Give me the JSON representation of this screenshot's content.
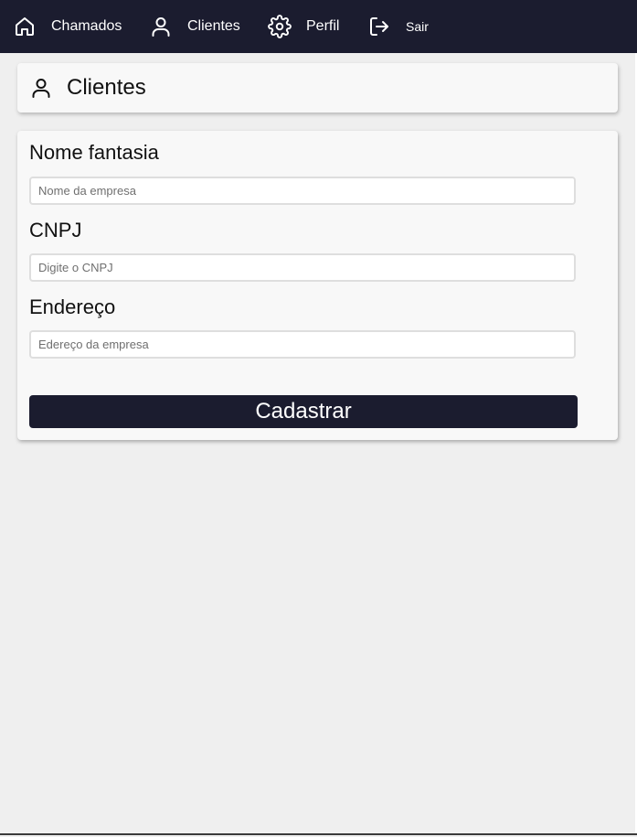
{
  "nav": {
    "items": [
      {
        "label": "Chamados",
        "icon": "home-icon"
      },
      {
        "label": "Clientes",
        "icon": "user-icon"
      },
      {
        "label": "Perfil",
        "icon": "gear-icon"
      },
      {
        "label": "Sair",
        "icon": "logout-icon"
      }
    ]
  },
  "page": {
    "title": "Clientes",
    "title_icon": "user-icon"
  },
  "form": {
    "fields": [
      {
        "label": "Nome fantasia",
        "value": "",
        "placeholder": "Nome da empresa"
      },
      {
        "label": "CNPJ",
        "value": "",
        "placeholder": "Digite o CNPJ"
      },
      {
        "label": "Endereço",
        "value": "",
        "placeholder": "Edereço da empresa"
      }
    ],
    "submit_label": "Cadastrar"
  },
  "colors": {
    "navbar": "#1b1c2f",
    "background": "#efefef",
    "card": "#f8f8f8",
    "button": "#1b1c2f"
  }
}
